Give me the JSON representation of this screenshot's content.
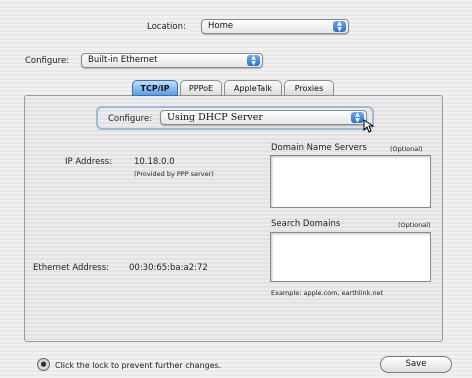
{
  "location": {
    "label": "Location:",
    "value": "Home"
  },
  "configure_top": {
    "label": "Configure:",
    "value": "Built-in Ethernet"
  },
  "tabs": [
    {
      "label": "TCP/IP",
      "active": true
    },
    {
      "label": "PPPoE",
      "active": false
    },
    {
      "label": "AppleTalk",
      "active": false
    },
    {
      "label": "Proxies",
      "active": false
    }
  ],
  "tcpip": {
    "configure_label": "Configure:",
    "configure_value": "Using DHCP Server",
    "ip_label": "IP Address:",
    "ip_value": "10.18.0.0",
    "ip_note": "(Provided by PPP server)",
    "dns_label": "Domain Name Servers",
    "dns_optional": "(Optional)",
    "search_label": "Search Domains",
    "search_optional": "(Optional)",
    "example": "Example: apple.com, earthlink.net",
    "ethernet_label": "Ethernet Address:",
    "ethernet_value": "00:30:65:ba:a2:72"
  },
  "footer": {
    "lock_text": "Click the lock to prevent further changes.",
    "save_label": "Save"
  },
  "icons": {
    "popup_arrows": "updown-arrows-icon",
    "cursor": "cursor-arrow-icon",
    "lock": "lock-icon"
  }
}
